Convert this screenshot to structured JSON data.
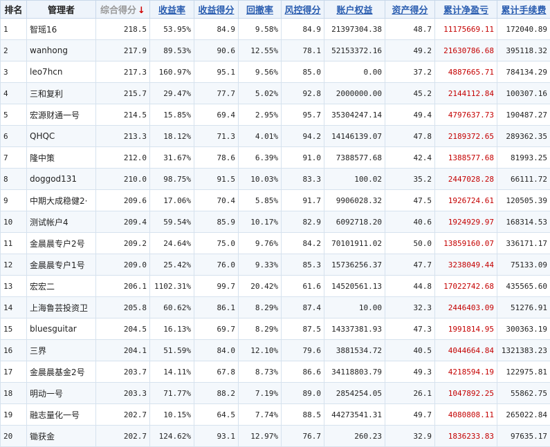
{
  "headers": {
    "rank": "排名",
    "manager": "管理者",
    "total_score": "综合得分",
    "sort_arrow": "↓",
    "return_rate": "收益率",
    "return_score": "收益得分",
    "drawdown": "回撤率",
    "risk_score": "风控得分",
    "equity": "账户权益",
    "asset_score": "资产得分",
    "net_pnl": "累计净盈亏",
    "fees": "累计手续费"
  },
  "rows": [
    {
      "rank": "1",
      "manager": "智瑶16",
      "total_score": "218.5",
      "return_rate": "53.95%",
      "return_score": "84.9",
      "drawdown": "9.58%",
      "risk_score": "84.9",
      "equity": "21397304.38",
      "asset_score": "48.7",
      "net_pnl": "11175669.11",
      "fees": "172040.89"
    },
    {
      "rank": "2",
      "manager": "wanhong",
      "total_score": "217.9",
      "return_rate": "89.53%",
      "return_score": "90.6",
      "drawdown": "12.55%",
      "risk_score": "78.1",
      "equity": "52153372.16",
      "asset_score": "49.2",
      "net_pnl": "21630786.68",
      "fees": "395118.32"
    },
    {
      "rank": "3",
      "manager": "leo7hcn",
      "total_score": "217.3",
      "return_rate": "160.97%",
      "return_score": "95.1",
      "drawdown": "9.56%",
      "risk_score": "85.0",
      "equity": "0.00",
      "asset_score": "37.2",
      "net_pnl": "4887665.71",
      "fees": "784134.29"
    },
    {
      "rank": "4",
      "manager": "三和复利",
      "total_score": "215.7",
      "return_rate": "29.47%",
      "return_score": "77.7",
      "drawdown": "5.02%",
      "risk_score": "92.8",
      "equity": "2000000.00",
      "asset_score": "45.2",
      "net_pnl": "2144112.84",
      "fees": "100307.16"
    },
    {
      "rank": "5",
      "manager": "宏源财通一号",
      "total_score": "214.5",
      "return_rate": "15.85%",
      "return_score": "69.4",
      "drawdown": "2.95%",
      "risk_score": "95.7",
      "equity": "35304247.14",
      "asset_score": "49.4",
      "net_pnl": "4797637.73",
      "fees": "190487.27"
    },
    {
      "rank": "6",
      "manager": "QHQC",
      "total_score": "213.3",
      "return_rate": "18.12%",
      "return_score": "71.3",
      "drawdown": "4.01%",
      "risk_score": "94.2",
      "equity": "14146139.07",
      "asset_score": "47.8",
      "net_pnl": "2189372.65",
      "fees": "289362.35"
    },
    {
      "rank": "7",
      "manager": "隆中策",
      "total_score": "212.0",
      "return_rate": "31.67%",
      "return_score": "78.6",
      "drawdown": "6.39%",
      "risk_score": "91.0",
      "equity": "7388577.68",
      "asset_score": "42.4",
      "net_pnl": "1388577.68",
      "fees": "81993.25"
    },
    {
      "rank": "8",
      "manager": "doggod131",
      "total_score": "210.0",
      "return_rate": "98.75%",
      "return_score": "91.5",
      "drawdown": "10.03%",
      "risk_score": "83.3",
      "equity": "100.02",
      "asset_score": "35.2",
      "net_pnl": "2447028.28",
      "fees": "66111.72"
    },
    {
      "rank": "9",
      "manager": "中期大成稳健2·",
      "total_score": "209.6",
      "return_rate": "17.06%",
      "return_score": "70.4",
      "drawdown": "5.85%",
      "risk_score": "91.7",
      "equity": "9906028.32",
      "asset_score": "47.5",
      "net_pnl": "1926724.61",
      "fees": "120505.39"
    },
    {
      "rank": "10",
      "manager": "测试帐户4",
      "total_score": "209.4",
      "return_rate": "59.54%",
      "return_score": "85.9",
      "drawdown": "10.17%",
      "risk_score": "82.9",
      "equity": "6092718.20",
      "asset_score": "40.6",
      "net_pnl": "1924929.97",
      "fees": "168314.53"
    },
    {
      "rank": "11",
      "manager": "金晨晨专户2号",
      "total_score": "209.2",
      "return_rate": "24.64%",
      "return_score": "75.0",
      "drawdown": "9.76%",
      "risk_score": "84.2",
      "equity": "70101911.02",
      "asset_score": "50.0",
      "net_pnl": "13859160.07",
      "fees": "336171.17"
    },
    {
      "rank": "12",
      "manager": "金晨晨专户1号",
      "total_score": "209.0",
      "return_rate": "25.42%",
      "return_score": "76.0",
      "drawdown": "9.33%",
      "risk_score": "85.3",
      "equity": "15736256.37",
      "asset_score": "47.7",
      "net_pnl": "3238049.44",
      "fees": "75133.09"
    },
    {
      "rank": "13",
      "manager": "宏宏二",
      "total_score": "206.1",
      "return_rate": "1102.31%",
      "return_score": "99.7",
      "drawdown": "20.42%",
      "risk_score": "61.6",
      "equity": "14520561.13",
      "asset_score": "44.8",
      "net_pnl": "17022742.68",
      "fees": "435565.60"
    },
    {
      "rank": "14",
      "manager": "上海鲁芸投资卫",
      "total_score": "205.8",
      "return_rate": "60.62%",
      "return_score": "86.1",
      "drawdown": "8.29%",
      "risk_score": "87.4",
      "equity": "10.00",
      "asset_score": "32.3",
      "net_pnl": "2446403.09",
      "fees": "51276.91"
    },
    {
      "rank": "15",
      "manager": "bluesguitar",
      "total_score": "204.5",
      "return_rate": "16.13%",
      "return_score": "69.7",
      "drawdown": "8.29%",
      "risk_score": "87.5",
      "equity": "14337381.93",
      "asset_score": "47.3",
      "net_pnl": "1991814.95",
      "fees": "300363.19"
    },
    {
      "rank": "16",
      "manager": "三界",
      "total_score": "204.1",
      "return_rate": "51.59%",
      "return_score": "84.0",
      "drawdown": "12.10%",
      "risk_score": "79.6",
      "equity": "3881534.72",
      "asset_score": "40.5",
      "net_pnl": "4044664.84",
      "fees": "1321383.23"
    },
    {
      "rank": "17",
      "manager": "金晨晨基金2号",
      "total_score": "203.7",
      "return_rate": "14.11%",
      "return_score": "67.8",
      "drawdown": "8.73%",
      "risk_score": "86.6",
      "equity": "34118803.79",
      "asset_score": "49.3",
      "net_pnl": "4218594.19",
      "fees": "122975.81"
    },
    {
      "rank": "18",
      "manager": "明动一号",
      "total_score": "203.3",
      "return_rate": "71.77%",
      "return_score": "88.2",
      "drawdown": "7.19%",
      "risk_score": "89.0",
      "equity": "2854254.05",
      "asset_score": "26.1",
      "net_pnl": "1047892.25",
      "fees": "55862.75"
    },
    {
      "rank": "19",
      "manager": "融志量化一号",
      "total_score": "202.7",
      "return_rate": "10.15%",
      "return_score": "64.5",
      "drawdown": "7.74%",
      "risk_score": "88.5",
      "equity": "44273541.31",
      "asset_score": "49.7",
      "net_pnl": "4080808.11",
      "fees": "265022.84"
    },
    {
      "rank": "20",
      "manager": "锄获金",
      "total_score": "202.7",
      "return_rate": "124.62%",
      "return_score": "93.1",
      "drawdown": "12.97%",
      "risk_score": "76.7",
      "equity": "260.23",
      "asset_score": "32.9",
      "net_pnl": "1836233.83",
      "fees": "97635.17"
    }
  ],
  "colors": {
    "header_bg": "#eef4fb",
    "header_link": "#2a5db0",
    "stripe_bg": "#f4f8fc",
    "pnl_red": "#c40000",
    "sort_arrow": "#d00000"
  }
}
